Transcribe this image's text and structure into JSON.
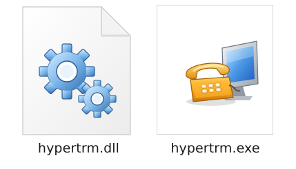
{
  "files": [
    {
      "name": "hypertrm.dll",
      "icon": "document-gears-icon"
    },
    {
      "name": "hypertrm.exe",
      "icon": "phone-computer-icon"
    }
  ],
  "colors": {
    "page_border": "#d6d6d6",
    "gear_blue": "#6fa6d9",
    "phone_orange": "#f4a11a",
    "monitor_blue": "#3a7fd6"
  }
}
